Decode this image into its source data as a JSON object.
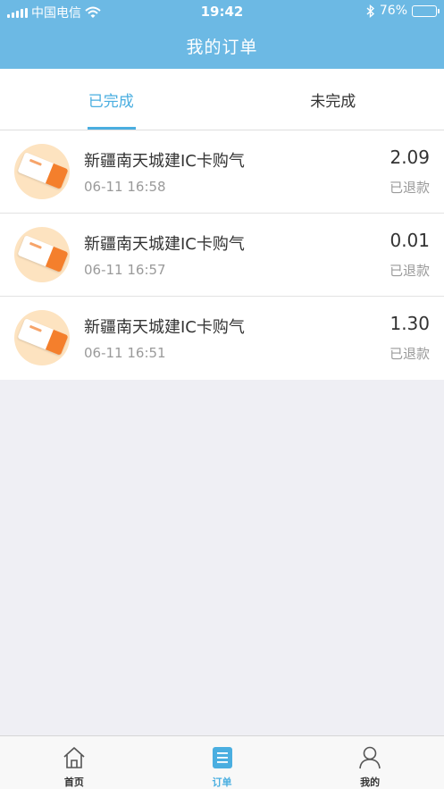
{
  "status_bar": {
    "carrier": "中国电信",
    "time": "19:42",
    "battery_percent": "76%",
    "battery_level": 0.76,
    "icons": [
      "signal-icon",
      "wifi-icon",
      "bluetooth-icon",
      "battery-icon"
    ]
  },
  "header": {
    "title": "我的订单",
    "background_color": "#6cb9e4"
  },
  "tabs": [
    {
      "label": "已完成",
      "active": true
    },
    {
      "label": "未完成",
      "active": false
    }
  ],
  "orders": [
    {
      "name": "新疆南天城建IC卡购气",
      "time": "06-11 16:58",
      "amount": "2.09",
      "status": "已退款"
    },
    {
      "name": "新疆南天城建IC卡购气",
      "time": "06-11 16:57",
      "amount": "0.01",
      "status": "已退款"
    },
    {
      "name": "新疆南天城建IC卡购气",
      "time": "06-11 16:51",
      "amount": "1.30",
      "status": "已退款"
    }
  ],
  "tabbar": [
    {
      "label": "首页",
      "icon": "home-icon",
      "active": false
    },
    {
      "label": "订单",
      "icon": "order-list-icon",
      "active": true
    },
    {
      "label": "我的",
      "icon": "user-icon",
      "active": false
    }
  ],
  "colors": {
    "accent": "#4aaee0",
    "thumb_background": "#fde3c0",
    "card_orange": "#f47f2c"
  }
}
